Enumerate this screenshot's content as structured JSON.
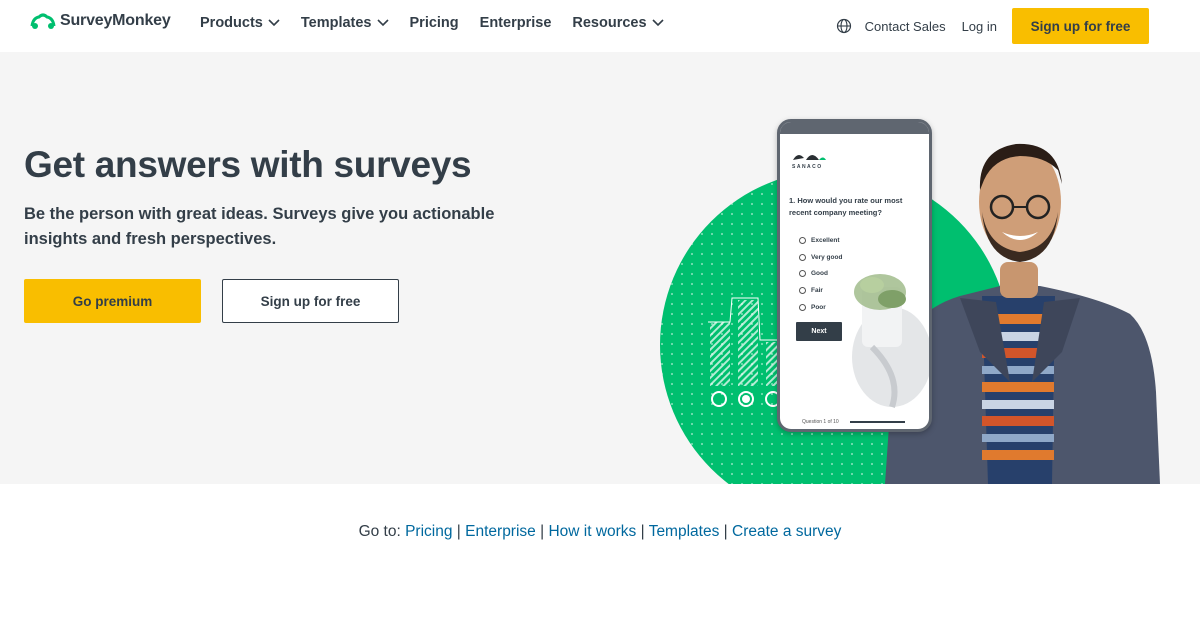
{
  "nav": {
    "logo_text": "SurveyMonkey",
    "links": [
      {
        "label": "Products",
        "dropdown": true
      },
      {
        "label": "Templates",
        "dropdown": true
      },
      {
        "label": "Pricing",
        "dropdown": false
      },
      {
        "label": "Enterprise",
        "dropdown": false
      },
      {
        "label": "Resources",
        "dropdown": true
      }
    ],
    "contact_sales": "Contact Sales",
    "log_in": "Log in",
    "signup_label": "Sign up for free"
  },
  "hero": {
    "headline": "Get answers with surveys",
    "subhead": "Be the person with great ideas. Surveys give you actionable insights and fresh perspectives.",
    "premium_label": "Go premium",
    "free_label": "Sign up for free"
  },
  "phone": {
    "brand": "SANACO",
    "question": "1. How would you rate our most recent company meeting?",
    "options": [
      "Excellent",
      "Very good",
      "Good",
      "Fair",
      "Poor"
    ],
    "next_label": "Next",
    "progress_text": "Question 1 of 10"
  },
  "goto": {
    "prefix": "Go to:",
    "links": [
      "Pricing",
      "Enterprise",
      "How it works",
      "Templates",
      "Create a survey"
    ]
  },
  "colors": {
    "accent_yellow": "#f9be00",
    "brand_green": "#00bf6f",
    "link_blue": "#00689e",
    "text_dark": "#333e48"
  }
}
